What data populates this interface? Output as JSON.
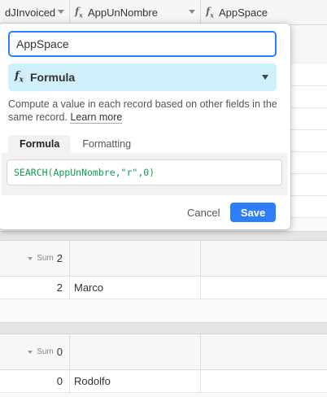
{
  "grid": {
    "columns": [
      {
        "label": "dJInvoiced",
        "icon": "none"
      },
      {
        "label": "AppUnNombre",
        "icon": "formula-icon"
      },
      {
        "label": "AppSpace",
        "icon": "formula-icon"
      }
    ],
    "groups": [
      {
        "sum_label": "Sum",
        "sum_value": "2",
        "rows": [
          {
            "invoiced": "2",
            "nombre": "Marco",
            "space": ""
          }
        ]
      },
      {
        "sum_label": "Sum",
        "sum_value": "0",
        "rows": [
          {
            "invoiced": "0",
            "nombre": "Rodolfo",
            "space": ""
          }
        ]
      }
    ]
  },
  "popup": {
    "field_name": "AppSpace",
    "field_type": "Formula",
    "field_type_icon": "formula-icon",
    "description": "Compute a value in each record based on other fields in the same record.",
    "learn_more": "Learn more",
    "tabs": [
      "Formula",
      "Formatting"
    ],
    "active_tab": "Formula",
    "formula": "SEARCH(AppUnNombre,\"r\",0)",
    "cancel_label": "Cancel",
    "save_label": "Save"
  },
  "colors": {
    "accent": "#2d7ff9",
    "type_bg": "#cfeffb",
    "formula_text": "#0f9d58"
  }
}
